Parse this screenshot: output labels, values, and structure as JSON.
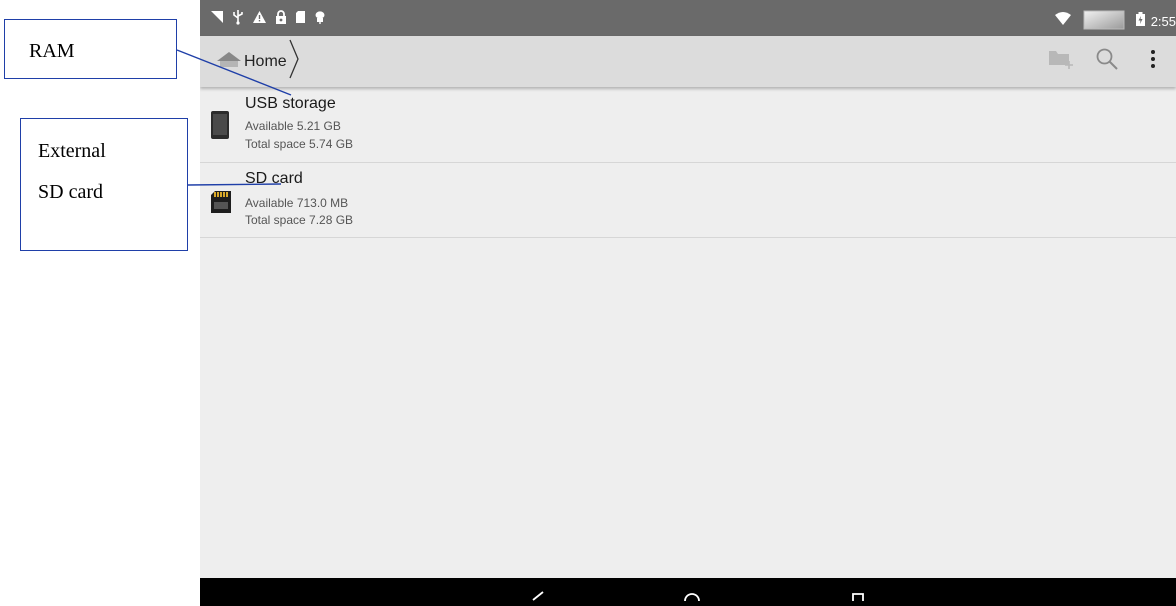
{
  "status_bar": {
    "time": "2:55",
    "icons": [
      "picture-icon",
      "usb-icon",
      "warning-icon",
      "lock-icon",
      "sd-icon",
      "android-icon",
      "wifi-icon",
      "battery-icon"
    ]
  },
  "toolbar": {
    "breadcrumb_label": "Home",
    "actions": [
      "new-folder-icon",
      "search-icon",
      "overflow-menu-icon"
    ]
  },
  "storage_items": [
    {
      "title": "USB storage",
      "available": "Available 5.21 GB",
      "total": "Total space 5.74 GB",
      "icon": "phone-storage-icon"
    },
    {
      "title": "SD card",
      "available": "Available 713.0 MB",
      "total": "Total space 7.28 GB",
      "icon": "sd-card-icon"
    }
  ],
  "annotations": {
    "ram_label": "RAM",
    "external_line1": "External",
    "external_line2": "SD card"
  },
  "colors": {
    "callout_border": "#1f3fa8",
    "status_bar": "#6a6a6a",
    "toolbar": "#dcdcdc",
    "background": "#eeeeee",
    "nav_bar": "#000000"
  }
}
